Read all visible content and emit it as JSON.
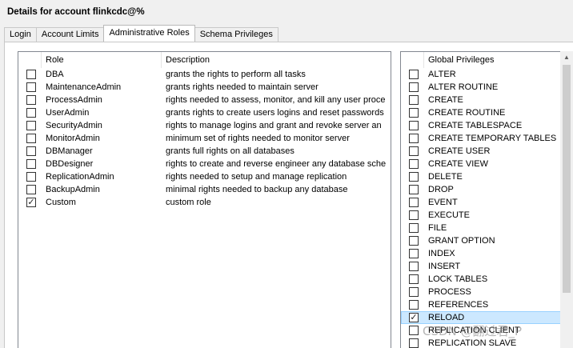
{
  "window": {
    "title": "Details for account flinkcdc@%"
  },
  "tabs": [
    {
      "label": "Login"
    },
    {
      "label": "Account Limits"
    },
    {
      "label": "Administrative Roles",
      "active": true
    },
    {
      "label": "Schema Privileges"
    }
  ],
  "roles_table": {
    "headers": {
      "role": "Role",
      "description": "Description"
    },
    "rows": [
      {
        "checked": false,
        "role": "DBA",
        "description": "grants the rights to perform all tasks"
      },
      {
        "checked": false,
        "role": "MaintenanceAdmin",
        "description": "grants rights needed to maintain server"
      },
      {
        "checked": false,
        "role": "ProcessAdmin",
        "description": "rights needed to assess, monitor, and kill any user proce"
      },
      {
        "checked": false,
        "role": "UserAdmin",
        "description": "grants rights to create users logins and reset passwords"
      },
      {
        "checked": false,
        "role": "SecurityAdmin",
        "description": "rights to manage logins and grant and revoke server an"
      },
      {
        "checked": false,
        "role": "MonitorAdmin",
        "description": "minimum set of rights needed to monitor server"
      },
      {
        "checked": false,
        "role": "DBManager",
        "description": "grants full rights on all databases"
      },
      {
        "checked": false,
        "role": "DBDesigner",
        "description": "rights to create and reverse engineer any database sche"
      },
      {
        "checked": false,
        "role": "ReplicationAdmin",
        "description": "rights needed to setup and manage replication"
      },
      {
        "checked": false,
        "role": "BackupAdmin",
        "description": "minimal rights needed to backup any database"
      },
      {
        "checked": true,
        "role": "Custom",
        "description": "custom role"
      }
    ]
  },
  "privileges_table": {
    "header": "Global Privileges",
    "rows": [
      {
        "checked": false,
        "name": "ALTER"
      },
      {
        "checked": false,
        "name": "ALTER ROUTINE"
      },
      {
        "checked": false,
        "name": "CREATE"
      },
      {
        "checked": false,
        "name": "CREATE ROUTINE"
      },
      {
        "checked": false,
        "name": "CREATE TABLESPACE"
      },
      {
        "checked": false,
        "name": "CREATE TEMPORARY TABLES"
      },
      {
        "checked": false,
        "name": "CREATE USER"
      },
      {
        "checked": false,
        "name": "CREATE VIEW"
      },
      {
        "checked": false,
        "name": "DELETE"
      },
      {
        "checked": false,
        "name": "DROP"
      },
      {
        "checked": false,
        "name": "EVENT"
      },
      {
        "checked": false,
        "name": "EXECUTE"
      },
      {
        "checked": false,
        "name": "FILE"
      },
      {
        "checked": false,
        "name": "GRANT OPTION"
      },
      {
        "checked": false,
        "name": "INDEX"
      },
      {
        "checked": false,
        "name": "INSERT"
      },
      {
        "checked": false,
        "name": "LOCK TABLES"
      },
      {
        "checked": false,
        "name": "PROCESS"
      },
      {
        "checked": false,
        "name": "REFERENCES"
      },
      {
        "checked": true,
        "name": "RELOAD",
        "selected": true
      },
      {
        "checked": false,
        "name": "REPLICATION CLIENT"
      },
      {
        "checked": false,
        "name": "REPLICATION SLAVE"
      }
    ]
  },
  "icons": {
    "checkmark": "check-icon",
    "scroll_up": "scroll-up-arrow-icon"
  },
  "colors": {
    "selection_bg": "#cce8ff",
    "selection_border": "#99d1ff"
  },
  "watermark": "CSDN @翻过君_P"
}
